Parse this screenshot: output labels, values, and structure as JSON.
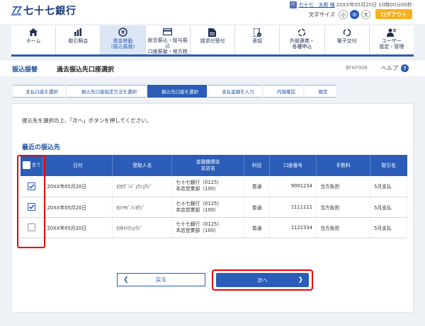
{
  "header": {
    "logo_mark": "77",
    "logo_bank": "BANK",
    "bank_name": "七十七銀行",
    "user_name": "七十七　太郎 様",
    "last_login": "20XX年05月20日 10時00分00秒",
    "font_size_label": "文字サイズ",
    "font_sizes": [
      "小",
      "中",
      "大"
    ],
    "font_size_selected": "中",
    "logout_label": "ログアウト"
  },
  "nav": [
    {
      "label": "ホーム",
      "icon": "home-icon"
    },
    {
      "label": "取引照会",
      "icon": "bar-chart-icon"
    },
    {
      "label": "資金移動\n(振込振替)",
      "icon": "transfer-icon"
    },
    {
      "label": "総合振込・給与振込\n口座振替・地方税",
      "icon": "card-icon"
    },
    {
      "label": "請求付受付",
      "icon": "document-icon"
    },
    {
      "label": "承認",
      "icon": "approve-icon"
    },
    {
      "label": "外部連携・\n各種申込",
      "icon": "link-icon"
    },
    {
      "label": "電子交付",
      "icon": "refresh-icon"
    },
    {
      "label": "ユーザー\n設定・管理",
      "icon": "user-settings-icon"
    }
  ],
  "title": {
    "section": "振込振替",
    "page": "過去振込先口座選択",
    "code": "BFKF006",
    "help": "ヘルプ"
  },
  "steps": [
    {
      "label": "支払口座を選択"
    },
    {
      "label": "振込先口座指定方法を選択"
    },
    {
      "label": "振込先口座を選択"
    },
    {
      "label": "支払金額を入力"
    },
    {
      "label": "内容確認"
    },
    {
      "label": "確定"
    }
  ],
  "active_step": 2,
  "instruction": "振込先を選択の上、「次へ」ボタンを押してください。",
  "section_title": "最近の振込先",
  "table": {
    "headers": {
      "all": "全て",
      "date": "日付",
      "payee": "受取人名",
      "bank": "金融機関名\n支店名",
      "type": "科目",
      "account": "口座番号",
      "fee": "手数料",
      "memo": "取引名"
    },
    "rows": [
      {
        "checked": true,
        "date": "20XX年05月20日",
        "payee": "ｶ)ｶﾜﾞﾝｼﾞｮｳｼｮｳｼﾞ",
        "bank": "七十七銀行（0125）",
        "branch": "本店営業部（100）",
        "type": "普通",
        "account": "9001234",
        "fee": "当方負担",
        "memo": "5月支払"
      },
      {
        "checked": true,
        "date": "20XX年05月20日",
        "payee": "ｶ)ﾐﾔｷﾞﾉｼﾖｳｼﾞ",
        "bank": "七十七銀行（0125）",
        "branch": "本店営業部（100）",
        "type": "普通",
        "account": "1111111",
        "fee": "当方負担",
        "memo": "5月支払"
      },
      {
        "checked": false,
        "date": "20XX年05月20日",
        "payee": "ｶ)ﾀｲﾊｸｼｮｳｼﾞ",
        "bank": "七十七銀行（0125）",
        "branch": "本店営業部（100）",
        "type": "普通",
        "account": "1122334",
        "fee": "当方負担",
        "memo": "5月支払"
      }
    ]
  },
  "buttons": {
    "back": "戻る",
    "next": "次へ"
  },
  "colors": {
    "primary": "#2a5cb8",
    "accent": "#f6b020",
    "highlight": "#e00000"
  }
}
